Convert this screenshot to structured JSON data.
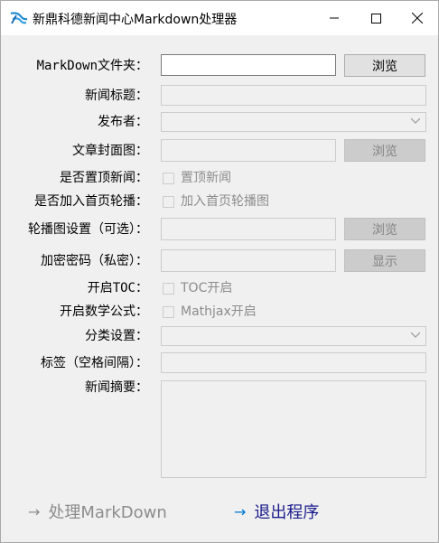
{
  "window": {
    "title": "新鼎科德新闻中心Markdown处理器",
    "controls": [
      "minimize",
      "maximize",
      "close"
    ]
  },
  "form": {
    "markdown_folder": {
      "label": "MarkDown文件夹：",
      "value": "",
      "browse_label": "浏览"
    },
    "news_title": {
      "label": "新闻标题：",
      "value": ""
    },
    "publisher": {
      "label": "发布者：",
      "selected": ""
    },
    "cover_image": {
      "label": "文章封面图：",
      "value": "",
      "browse_label": "浏览"
    },
    "pin_news": {
      "label": "是否置顶新闻：",
      "checkbox_label": "置顶新闻",
      "checked": false
    },
    "homepage_carousel": {
      "label": "是否加入首页轮播：",
      "checkbox_label": "加入首页轮播图",
      "checked": false
    },
    "carousel_image": {
      "label": "轮播图设置（可选）：",
      "value": "",
      "browse_label": "浏览"
    },
    "password": {
      "label": "加密密码（私密）：",
      "value": "",
      "show_label": "显示"
    },
    "toc": {
      "label": "开启TOC：",
      "checkbox_label": "TOC开启",
      "checked": false
    },
    "math": {
      "label": "开启数学公式：",
      "checkbox_label": "Mathjax开启",
      "checked": false
    },
    "category": {
      "label": "分类设置：",
      "selected": ""
    },
    "tags": {
      "label": "标签（空格间隔）：",
      "value": ""
    },
    "summary": {
      "label": "新闻摘要：",
      "value": ""
    }
  },
  "actions": {
    "process": {
      "label": "处理MarkDown",
      "arrow": "→",
      "enabled": false
    },
    "exit": {
      "label": "退出程序",
      "arrow": "→",
      "enabled": true
    }
  },
  "colors": {
    "accent": "#0078d7",
    "disabled_text": "#8c8c8c",
    "link_text": "#1a1a8c"
  }
}
